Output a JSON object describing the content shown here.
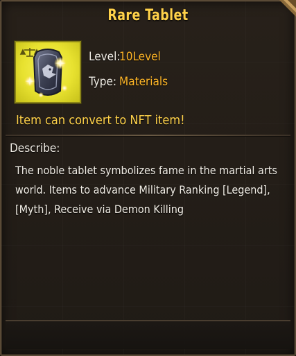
{
  "tooltip": {
    "title": "Rare Tablet",
    "level_label": "Level:",
    "level_value": "10Level",
    "type_label": "Type:",
    "type_value": "Materials",
    "nft_notice": "Item can convert to NFT item!",
    "describe_label": "Describe:",
    "description": "The noble tablet symbolizes fame in the martial arts world. Items to advance Military Ranking [Legend], [Myth], Receive via Demon Killing",
    "icon": "rare-tablet-icon"
  },
  "colors": {
    "title": "#ffd24a",
    "value": "#ffb627",
    "text": "#f2eee6",
    "icon_bg": "#e8e230",
    "panel_bg": "#28211a",
    "border": "#5a4a36"
  }
}
